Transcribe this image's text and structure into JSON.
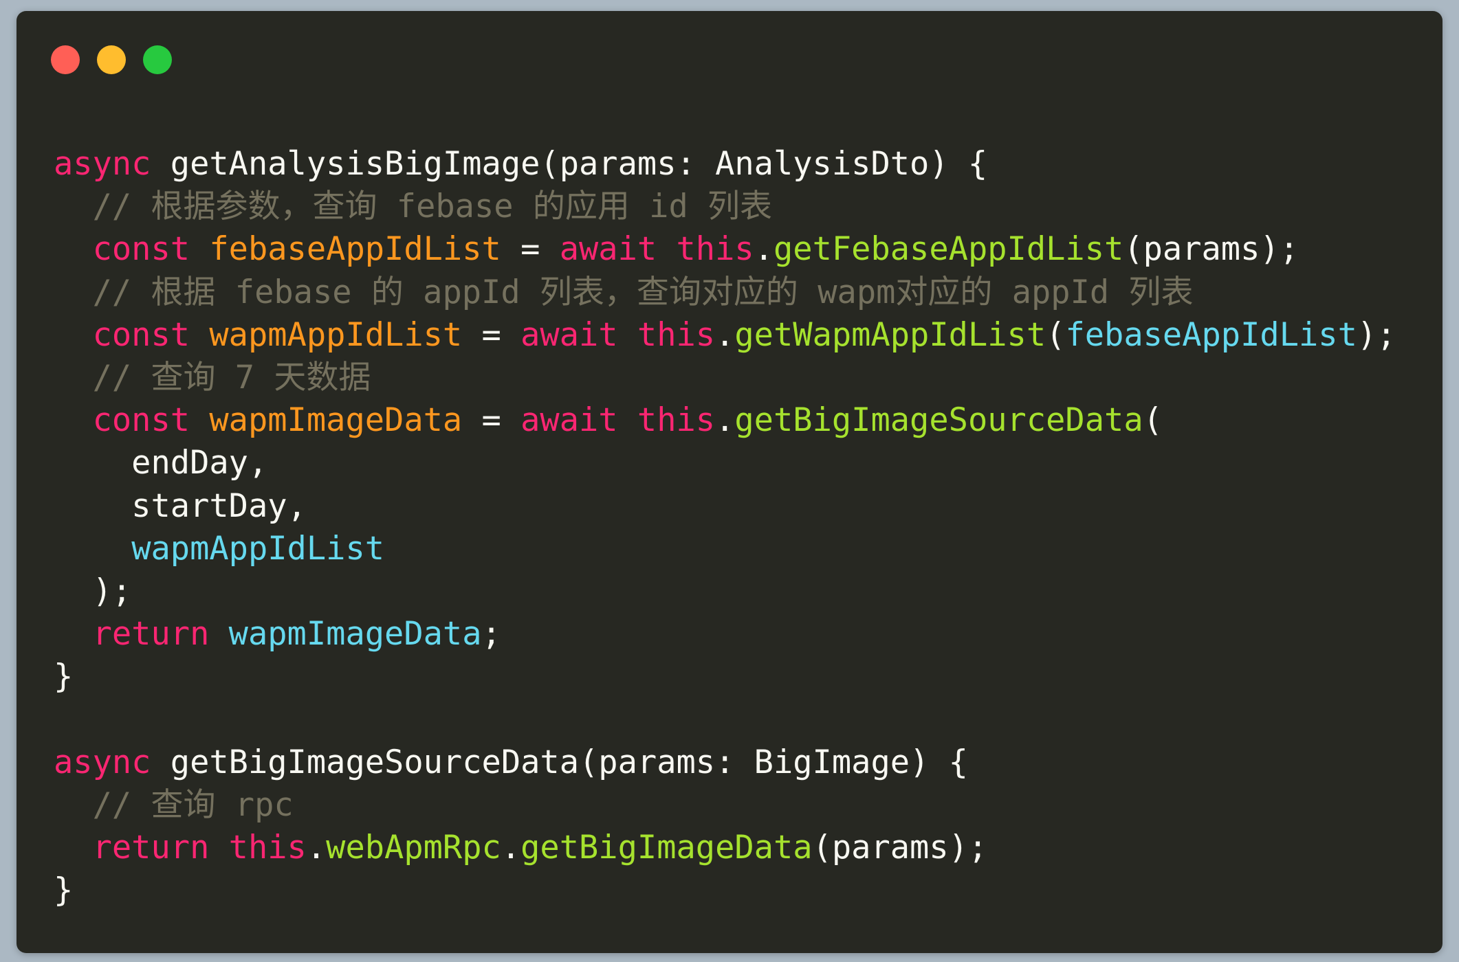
{
  "window": {
    "controls": [
      {
        "name": "close-button",
        "color": "#ff5f56"
      },
      {
        "name": "minimize-button",
        "color": "#ffbd2e"
      },
      {
        "name": "maximize-button",
        "color": "#27c93f"
      }
    ]
  },
  "code_lines": [
    [
      [
        "keyword",
        "async"
      ],
      [
        "plain",
        " getAnalysisBigImage(params: AnalysisDto) {"
      ]
    ],
    [
      [
        "comment",
        "  // 根据参数，查询 febase 的应用 id 列表"
      ]
    ],
    [
      [
        "plain",
        "  "
      ],
      [
        "keyword",
        "const"
      ],
      [
        "plain",
        " "
      ],
      [
        "decl",
        "febaseAppIdList"
      ],
      [
        "plain",
        " = "
      ],
      [
        "keyword",
        "await"
      ],
      [
        "plain",
        " "
      ],
      [
        "keyword",
        "this"
      ],
      [
        "plain",
        "."
      ],
      [
        "func",
        "getFebaseAppIdList"
      ],
      [
        "plain",
        "(params);"
      ]
    ],
    [
      [
        "comment",
        "  // 根据 febase 的 appId 列表，查询对应的 wapm对应的 appId 列表"
      ]
    ],
    [
      [
        "plain",
        "  "
      ],
      [
        "keyword",
        "const"
      ],
      [
        "plain",
        " "
      ],
      [
        "decl",
        "wapmAppIdList"
      ],
      [
        "plain",
        " = "
      ],
      [
        "keyword",
        "await"
      ],
      [
        "plain",
        " "
      ],
      [
        "keyword",
        "this"
      ],
      [
        "plain",
        "."
      ],
      [
        "func",
        "getWapmAppIdList"
      ],
      [
        "plain",
        "("
      ],
      [
        "var",
        "febaseAppIdList"
      ],
      [
        "plain",
        ");"
      ]
    ],
    [
      [
        "comment",
        "  // 查询 7 天数据"
      ]
    ],
    [
      [
        "plain",
        "  "
      ],
      [
        "keyword",
        "const"
      ],
      [
        "plain",
        " "
      ],
      [
        "decl",
        "wapmImageData"
      ],
      [
        "plain",
        " = "
      ],
      [
        "keyword",
        "await"
      ],
      [
        "plain",
        " "
      ],
      [
        "keyword",
        "this"
      ],
      [
        "plain",
        "."
      ],
      [
        "func",
        "getBigImageSourceData"
      ],
      [
        "plain",
        "("
      ]
    ],
    [
      [
        "plain",
        "    endDay,"
      ]
    ],
    [
      [
        "plain",
        "    startDay,"
      ]
    ],
    [
      [
        "plain",
        "    "
      ],
      [
        "var",
        "wapmAppIdList"
      ]
    ],
    [
      [
        "plain",
        "  );"
      ]
    ],
    [
      [
        "plain",
        "  "
      ],
      [
        "keyword",
        "return"
      ],
      [
        "plain",
        " "
      ],
      [
        "var",
        "wapmImageData"
      ],
      [
        "plain",
        ";"
      ]
    ],
    [
      [
        "plain",
        "}"
      ]
    ],
    [
      [
        "plain",
        ""
      ]
    ],
    [
      [
        "keyword",
        "async"
      ],
      [
        "plain",
        " getBigImageSourceData(params: BigImage) {"
      ]
    ],
    [
      [
        "comment",
        "  // 查询 rpc"
      ]
    ],
    [
      [
        "plain",
        "  "
      ],
      [
        "keyword",
        "return"
      ],
      [
        "plain",
        " "
      ],
      [
        "keyword",
        "this"
      ],
      [
        "plain",
        "."
      ],
      [
        "func",
        "webApmRpc"
      ],
      [
        "plain",
        "."
      ],
      [
        "func",
        "getBigImageData"
      ],
      [
        "plain",
        "(params);"
      ]
    ],
    [
      [
        "plain",
        "}"
      ]
    ]
  ]
}
